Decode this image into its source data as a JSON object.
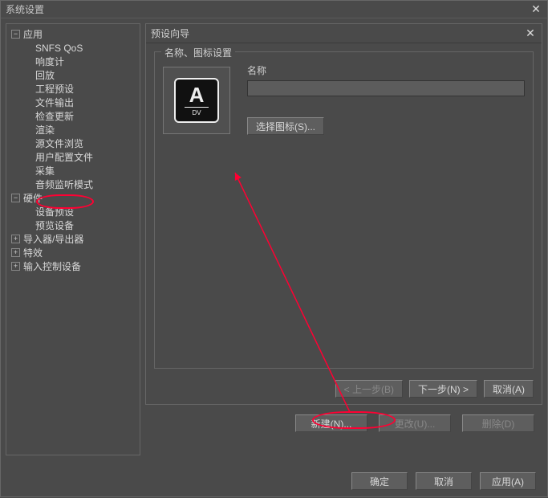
{
  "window": {
    "title": "系统设置"
  },
  "tree": {
    "app": {
      "label": "应用",
      "children": [
        "SNFS QoS",
        "响度计",
        "回放",
        "工程预设",
        "文件输出",
        "检查更新",
        "渲染",
        "源文件浏览",
        "用户配置文件",
        "采集",
        "音频监听模式"
      ]
    },
    "hardware": {
      "label": "硬件",
      "children": [
        "设备预设",
        "预览设备"
      ]
    },
    "importer": {
      "label": "导入器/导出器"
    },
    "fx": {
      "label": "特效"
    },
    "inputctl": {
      "label": "输入控制设备"
    }
  },
  "wizard": {
    "title": "预设向导",
    "group_title": "名称、图标设置",
    "name_label": "名称",
    "name_value": "",
    "select_icon": "选择图标(S)...",
    "icon_text": "DV",
    "prev": "< 上一步(B)",
    "next": "下一步(N) >",
    "cancel": "取消(A)"
  },
  "middle": {
    "new": "新建(N)...",
    "change": "更改(U)...",
    "delete": "删除(D)"
  },
  "bottom": {
    "ok": "确定",
    "cancel": "取消",
    "apply": "应用(A)"
  }
}
